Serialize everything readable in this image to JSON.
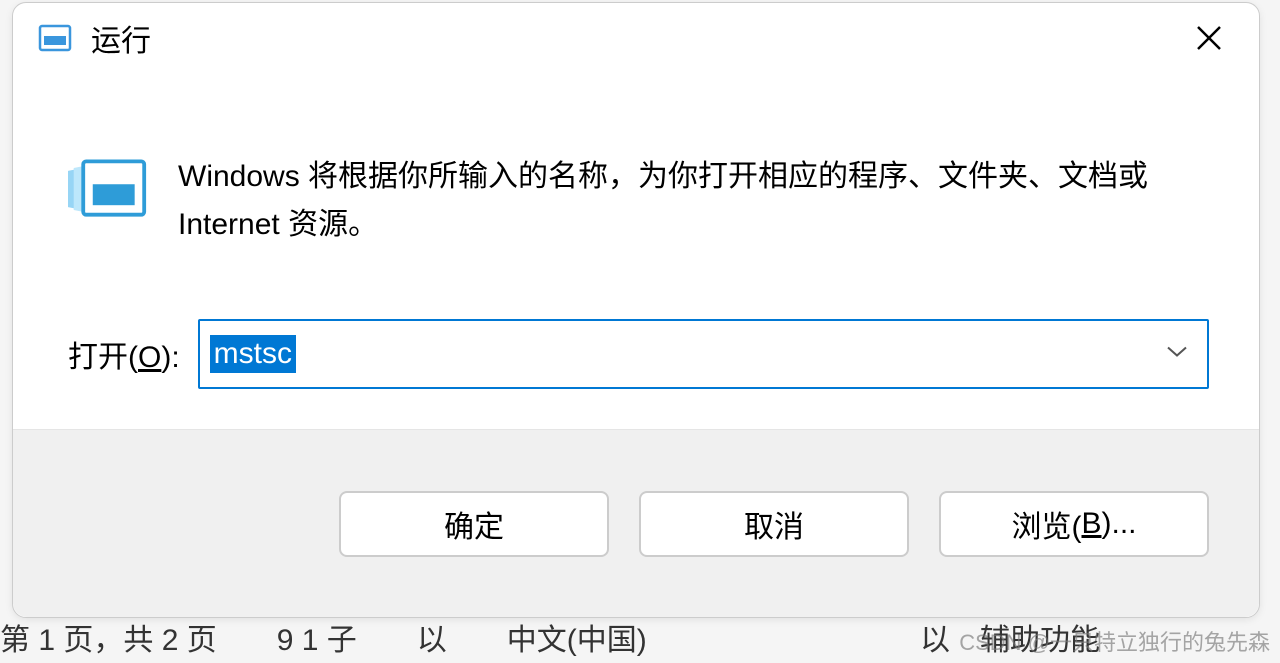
{
  "dialog": {
    "title": "运行",
    "description": "Windows 将根据你所输入的名称，为你打开相应的程序、文件夹、文档或 Internet 资源。",
    "open_label_prefix": "打开(",
    "open_label_hotkey": "O",
    "open_label_suffix": "):",
    "input_value": "mstsc",
    "buttons": {
      "ok": "确定",
      "cancel": "取消",
      "browse_prefix": "浏览(",
      "browse_hotkey": "B",
      "browse_suffix": ")..."
    }
  },
  "background": {
    "left_text": "第 1 页，共 2 页  9 1 子  以  中文(中国)",
    "right_text": "以 辅助功能      "
  },
  "watermark": "CSDN @一只特立独行的兔先森"
}
